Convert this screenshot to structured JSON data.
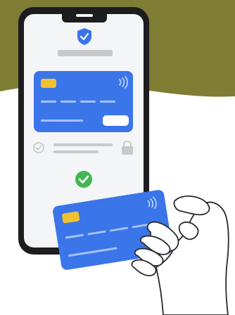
{
  "colors": {
    "olive_band": "#7f7d33",
    "background": "#ffffff",
    "phone_frame": "#1d1d1f",
    "phone_screen": "#f4f5f7",
    "card_blue": "#3a75ea",
    "card_blue_dark": "#2f63d4",
    "card_chip": "#f2c12e",
    "placeholder_gray": "#c7c9cd",
    "check_green": "#43b556",
    "outline_ink": "#2b2b2b"
  },
  "icons": {
    "shield": "shield-check-icon",
    "payment_success": "check-circle-icon",
    "radio": "check-radio-icon",
    "lock": "lock-icon",
    "contactless": "contactless-icon"
  },
  "status": {
    "payment_confirmed": true
  }
}
